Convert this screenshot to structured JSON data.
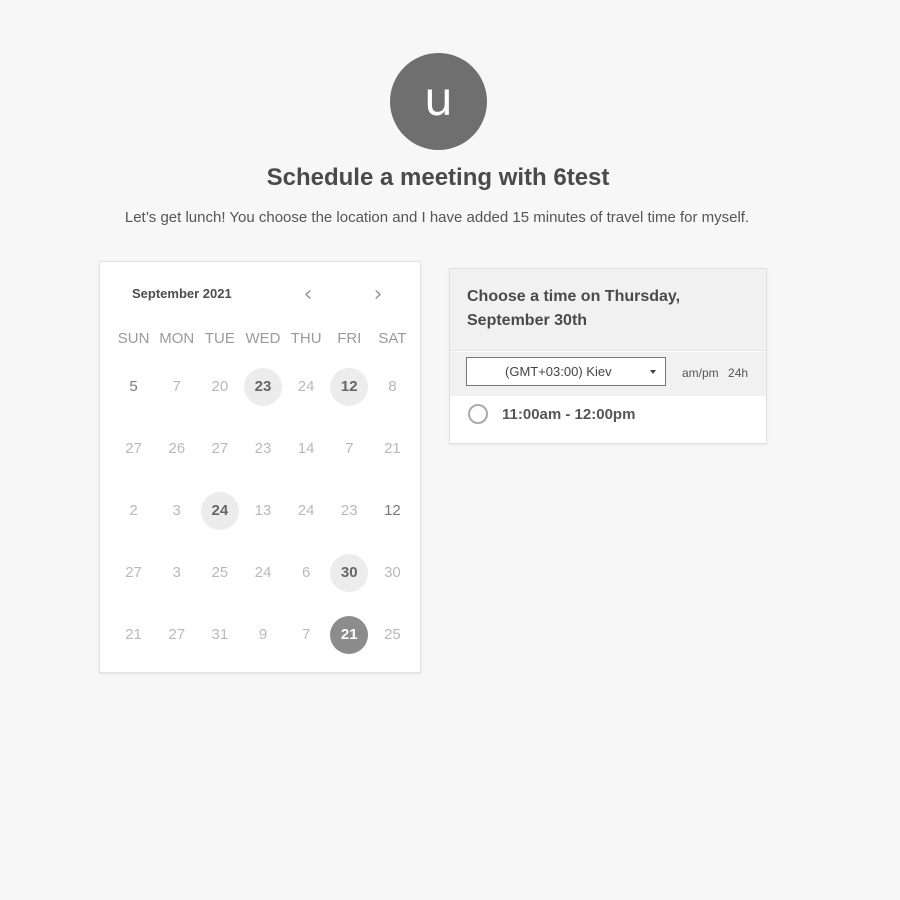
{
  "host": {
    "avatar_letter": "u",
    "title": "Schedule a meeting with 6test",
    "description": "Let’s get lunch! You choose the location and I have added 15 minutes of travel time for myself."
  },
  "calendar": {
    "month_label": "September 2021",
    "prev_icon": "‹",
    "next_icon": "›",
    "weekdays": [
      "SUN",
      "MON",
      "TUE",
      "WED",
      "THU",
      "FRI",
      "SAT"
    ],
    "weeks": [
      [
        {
          "d": "5",
          "s": "bold"
        },
        {
          "d": "7",
          "s": ""
        },
        {
          "d": "20",
          "s": ""
        },
        {
          "d": "23",
          "s": "available"
        },
        {
          "d": "24",
          "s": ""
        },
        {
          "d": "12",
          "s": "available"
        },
        {
          "d": "8",
          "s": ""
        }
      ],
      [
        {
          "d": "27",
          "s": ""
        },
        {
          "d": "26",
          "s": ""
        },
        {
          "d": "27",
          "s": ""
        },
        {
          "d": "23",
          "s": ""
        },
        {
          "d": "14",
          "s": ""
        },
        {
          "d": "7",
          "s": ""
        },
        {
          "d": "21",
          "s": ""
        }
      ],
      [
        {
          "d": "2",
          "s": ""
        },
        {
          "d": "3",
          "s": ""
        },
        {
          "d": "24",
          "s": "available"
        },
        {
          "d": "13",
          "s": ""
        },
        {
          "d": "24",
          "s": ""
        },
        {
          "d": "23",
          "s": ""
        },
        {
          "d": "12",
          "s": "bold"
        }
      ],
      [
        {
          "d": "27",
          "s": ""
        },
        {
          "d": "3",
          "s": ""
        },
        {
          "d": "25",
          "s": ""
        },
        {
          "d": "24",
          "s": ""
        },
        {
          "d": "6",
          "s": ""
        },
        {
          "d": "30",
          "s": "available"
        },
        {
          "d": "30",
          "s": ""
        }
      ],
      [
        {
          "d": "21",
          "s": ""
        },
        {
          "d": "27",
          "s": ""
        },
        {
          "d": "31",
          "s": ""
        },
        {
          "d": "9",
          "s": ""
        },
        {
          "d": "7",
          "s": ""
        },
        {
          "d": "21",
          "s": "selected"
        },
        {
          "d": "25",
          "s": ""
        }
      ]
    ]
  },
  "timepicker": {
    "header": "Choose a time on Thursday, September 30th",
    "timezone": "(GMT+03:00) Kiev",
    "format_ampm": "am/pm",
    "format_24h": "24h",
    "slots": [
      "11:00am - 12:00pm"
    ]
  },
  "colors": {
    "background": "#f7f7f7",
    "avatar": "#6f6f6f",
    "available_day": "#ececec",
    "selected_day": "#8c8c8c"
  }
}
